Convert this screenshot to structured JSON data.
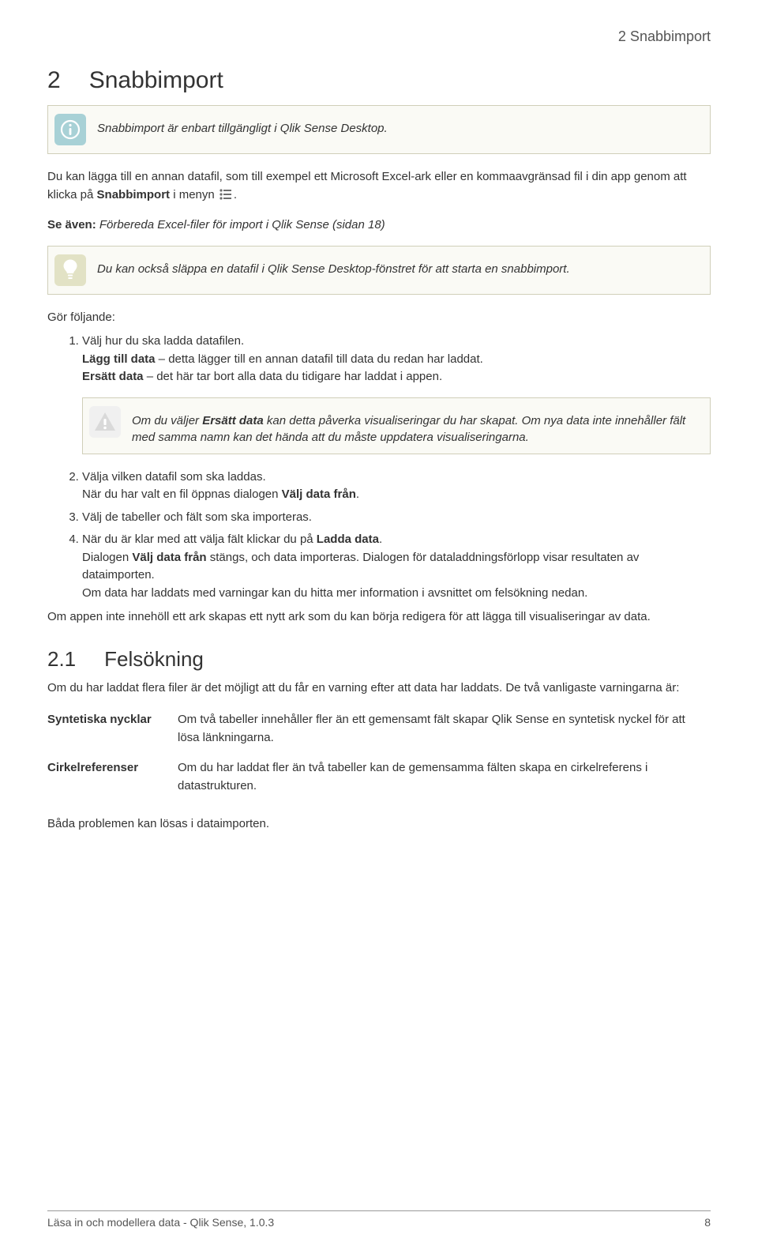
{
  "running_head": "2 Snabbimport",
  "chapter": {
    "number": "2",
    "title": "Snabbimport"
  },
  "info_callout": "Snabbimport är enbart tillgängligt i Qlik Sense Desktop.",
  "intro": {
    "pre": "Du kan lägga till en annan datafil, som till exempel ett Microsoft Excel-ark eller en kommaavgränsad fil i din app genom att klicka på ",
    "strong": "Snabbimport",
    "post": " i menyn ",
    "tail": "."
  },
  "see_also": {
    "label": "Se även:",
    "text": " Förbereda Excel-filer för import i Qlik Sense (sidan 18)"
  },
  "tip_callout": "Du kan också släppa en datafil i Qlik Sense Desktop-fönstret för att starta en snabbimport.",
  "steps_intro": "Gör följande:",
  "steps": [
    {
      "l1": "Välj hur du ska ladda datafilen.",
      "l2_strong": "Lägg till data",
      "l2_rest": " – detta lägger till en annan datafil till data du redan har laddat.",
      "l3_strong": "Ersätt data",
      "l3_rest": " – det här tar bort alla data du tidigare har laddat i appen."
    },
    {
      "l1": "Välja vilken datafil som ska laddas.",
      "l2_pre": "När du har valt en fil öppnas dialogen ",
      "l2_strong": "Välj data från",
      "l2_post": "."
    },
    {
      "l1": "Välj de tabeller och fält som ska importeras."
    },
    {
      "l1_pre": "När du är klar med att välja fält klickar du på ",
      "l1_strong": "Ladda data",
      "l1_post": ".",
      "l2_pre": "Dialogen ",
      "l2_strong": "Välj data från",
      "l2_post": " stängs, och data importeras. Dialogen för dataladdningsförlopp visar resultaten av dataimporten.",
      "l3": "Om data har laddats med varningar kan du hitta mer information i avsnittet om felsökning nedan."
    }
  ],
  "warn_callout": {
    "pre": "Om du väljer ",
    "strong": "Ersätt data",
    "post": " kan detta påverka visualiseringar du har skapat. Om nya data inte innehåller fält med samma namn kan det hända att du måste uppdatera visualiseringarna."
  },
  "outro": "Om appen inte innehöll ett ark skapas ett nytt ark som du kan börja redigera för att lägga till visualiseringar av data.",
  "section": {
    "number": "2.1",
    "title": "Felsökning",
    "intro": "Om du har laddat flera filer är det möjligt att du får en varning efter att data har laddats. De två vanligaste varningarna är:",
    "rows": [
      {
        "term": "Syntetiska nycklar",
        "def": "Om två tabeller innehåller fler än ett gemensamt fält skapar Qlik Sense en syntetisk nyckel för att lösa länkningarna."
      },
      {
        "term": "Cirkelreferenser",
        "def": "Om du har laddat fler än två tabeller kan de gemensamma fälten skapa en cirkelreferens i datastrukturen."
      }
    ],
    "closing": "Båda problemen kan lösas i dataimporten."
  },
  "footer": {
    "left": "Läsa in och modellera data - Qlik Sense, 1.0.3",
    "right": "8"
  }
}
